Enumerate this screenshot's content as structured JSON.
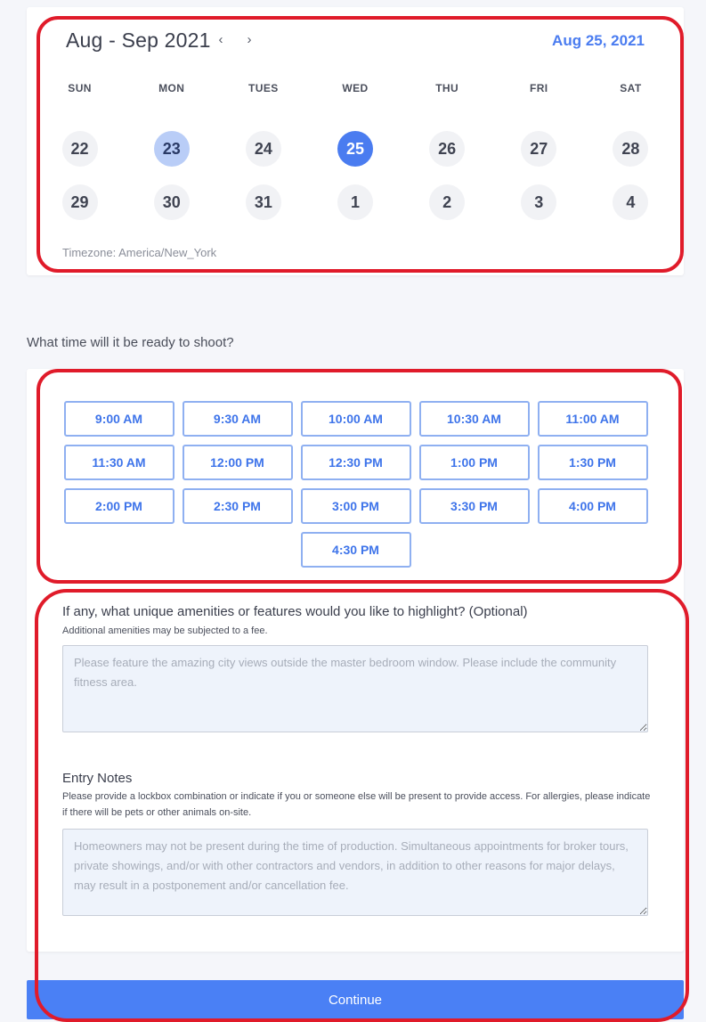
{
  "calendar": {
    "month_range": "Aug - Sep 2021",
    "prev_icon": "‹",
    "next_icon": "›",
    "selected_date": "Aug 25, 2021",
    "weekdays": [
      "SUN",
      "MON",
      "TUES",
      "WED",
      "THU",
      "FRI",
      "SAT"
    ],
    "days": [
      "22",
      "23",
      "24",
      "25",
      "26",
      "27",
      "28",
      "29",
      "30",
      "31",
      "1",
      "2",
      "3",
      "4"
    ],
    "today_day": "23",
    "selected_day": "25",
    "timezone": "Timezone: America/New_York"
  },
  "time_question": "What time will it be ready to shoot?",
  "time_slots": [
    "9:00 AM",
    "9:30 AM",
    "10:00 AM",
    "10:30 AM",
    "11:00 AM",
    "11:30 AM",
    "12:00 PM",
    "12:30 PM",
    "1:00 PM",
    "1:30 PM",
    "2:00 PM",
    "2:30 PM",
    "3:00 PM",
    "3:30 PM",
    "4:00 PM",
    "4:30 PM"
  ],
  "amenities": {
    "label": "If any, what unique amenities or features would you like to highlight? (Optional)",
    "hint": "Additional amenities may be subjected to a fee.",
    "placeholder": "Please feature the amazing city views outside the master bedroom window. Please include the community fitness area."
  },
  "entry_notes": {
    "label": "Entry Notes",
    "hint": "Please provide a lockbox combination or indicate if you or someone else will be present to provide access. For allergies, please indicate if there will be pets or other animals on-site.",
    "placeholder": "Homeowners may not be present during the time of production. Simultaneous appointments for broker tours, private showings, and/or with other contractors and vendors, in addition to other reasons for major delays, may result in a postponement and/or cancellation fee."
  },
  "continue_label": "Continue",
  "colors": {
    "accent": "#4a7cf0",
    "highlight": "#e01b2a",
    "today_fill": "#b9cdf7"
  }
}
